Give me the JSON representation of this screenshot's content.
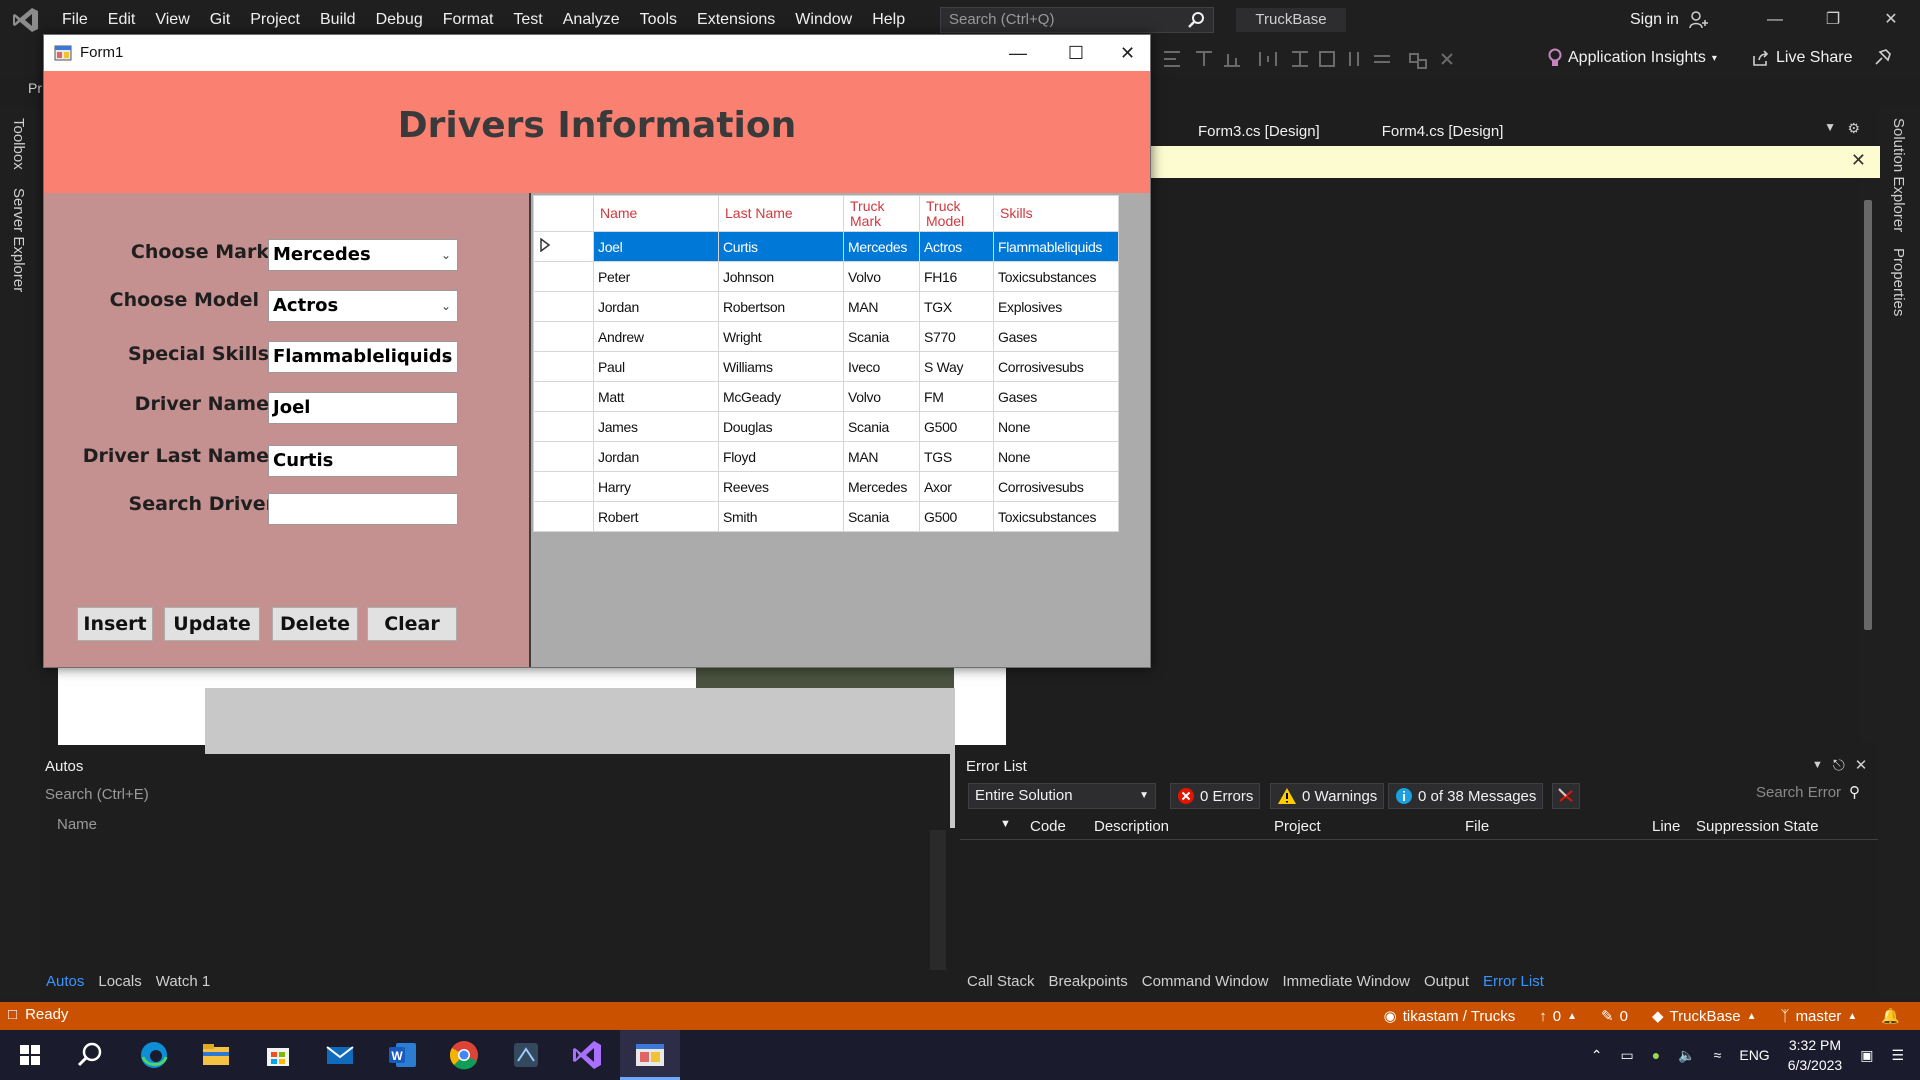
{
  "vs": {
    "menu": [
      "File",
      "Edit",
      "View",
      "Git",
      "Project",
      "Build",
      "Debug",
      "Format",
      "Test",
      "Analyze",
      "Tools",
      "Extensions",
      "Window",
      "Help"
    ],
    "search_placeholder": "Search (Ctrl+Q)",
    "solution_name": "TruckBase",
    "sign_in": "Sign in",
    "app_insights": "Application Insights",
    "live_share": "Live Share",
    "toolbar_stub": "Pr",
    "left_rail": [
      "Toolbox",
      "Server Explorer"
    ],
    "right_rail": [
      "Solution Explorer",
      "Properties"
    ],
    "doc_tabs": [
      "Form3.cs [Design]",
      "Form4.cs [Design]"
    ]
  },
  "autos": {
    "title": "Autos",
    "search_placeholder": "Search (Ctrl+E)",
    "col_name": "Name",
    "tabs": [
      "Autos",
      "Locals",
      "Watch 1"
    ]
  },
  "errors": {
    "title": "Error List",
    "scope": "Entire Solution",
    "errors_btn": "0 Errors",
    "warnings_btn": "0 Warnings",
    "messages_btn": "0 of 38 Messages",
    "search_placeholder": "Search Error",
    "columns": [
      "Code",
      "Description",
      "Project",
      "File",
      "Line",
      "Suppression State"
    ],
    "tabs": [
      "Call Stack",
      "Breakpoints",
      "Command Window",
      "Immediate Window",
      "Output",
      "Error List"
    ]
  },
  "status": {
    "ready": "Ready",
    "repo": "tikastam / Trucks",
    "push_count": "0",
    "pending_changes": "0",
    "solution": "TruckBase",
    "branch": "master"
  },
  "taskbar": {
    "lang": "ENG",
    "time": "3:32 PM",
    "date": "6/3/2023"
  },
  "form": {
    "window_title": "Form1",
    "header": "Drivers Information",
    "labels": {
      "mark": "Choose Mark",
      "model": "Choose Model",
      "skills": "Special Skills",
      "driver_name": "Driver Name",
      "driver_last_name": "Driver Last Name",
      "search": "Search Driver"
    },
    "values": {
      "mark": "Mercedes",
      "model": "Actros",
      "skills": "Flammableliquids",
      "driver_name": "Joel",
      "driver_last_name": "Curtis",
      "search": ""
    },
    "buttons": {
      "insert": "Insert",
      "update": "Update",
      "delete": "Delete",
      "clear": "Clear"
    },
    "grid": {
      "columns": [
        "Name",
        "Last Name",
        "Truck Mark",
        "Truck Model",
        "Skills"
      ],
      "rows": [
        [
          "Joel",
          "Curtis",
          "Mercedes",
          "Actros",
          "Flammableliquids"
        ],
        [
          "Peter",
          "Johnson",
          "Volvo",
          "FH16",
          "Toxicsubstances"
        ],
        [
          "Jordan",
          "Robertson",
          "MAN",
          "TGX",
          "Explosives"
        ],
        [
          "Andrew",
          "Wright",
          "Scania",
          "S770",
          "Gases"
        ],
        [
          "Paul",
          "Williams",
          "Iveco",
          "S Way",
          "Corrosivesubs"
        ],
        [
          "Matt",
          "McGeady",
          "Volvo",
          "FM",
          "Gases"
        ],
        [
          "James",
          "Douglas",
          "Scania",
          "G500",
          "None"
        ],
        [
          "Jordan",
          "Floyd",
          "MAN",
          "TGS",
          "None"
        ],
        [
          "Harry",
          "Reeves",
          "Mercedes",
          "Axor",
          "Corrosivesubs"
        ],
        [
          "Robert",
          "Smith",
          "Scania",
          "G500",
          "Toxicsubstances"
        ]
      ],
      "selected_row": 0
    }
  },
  "colors": {
    "vs_accent": "#ca5100",
    "form_header": "#fa8072",
    "form_body": "#c49090",
    "grid_header_text": "#d0383e",
    "selection": "#0078d7"
  }
}
